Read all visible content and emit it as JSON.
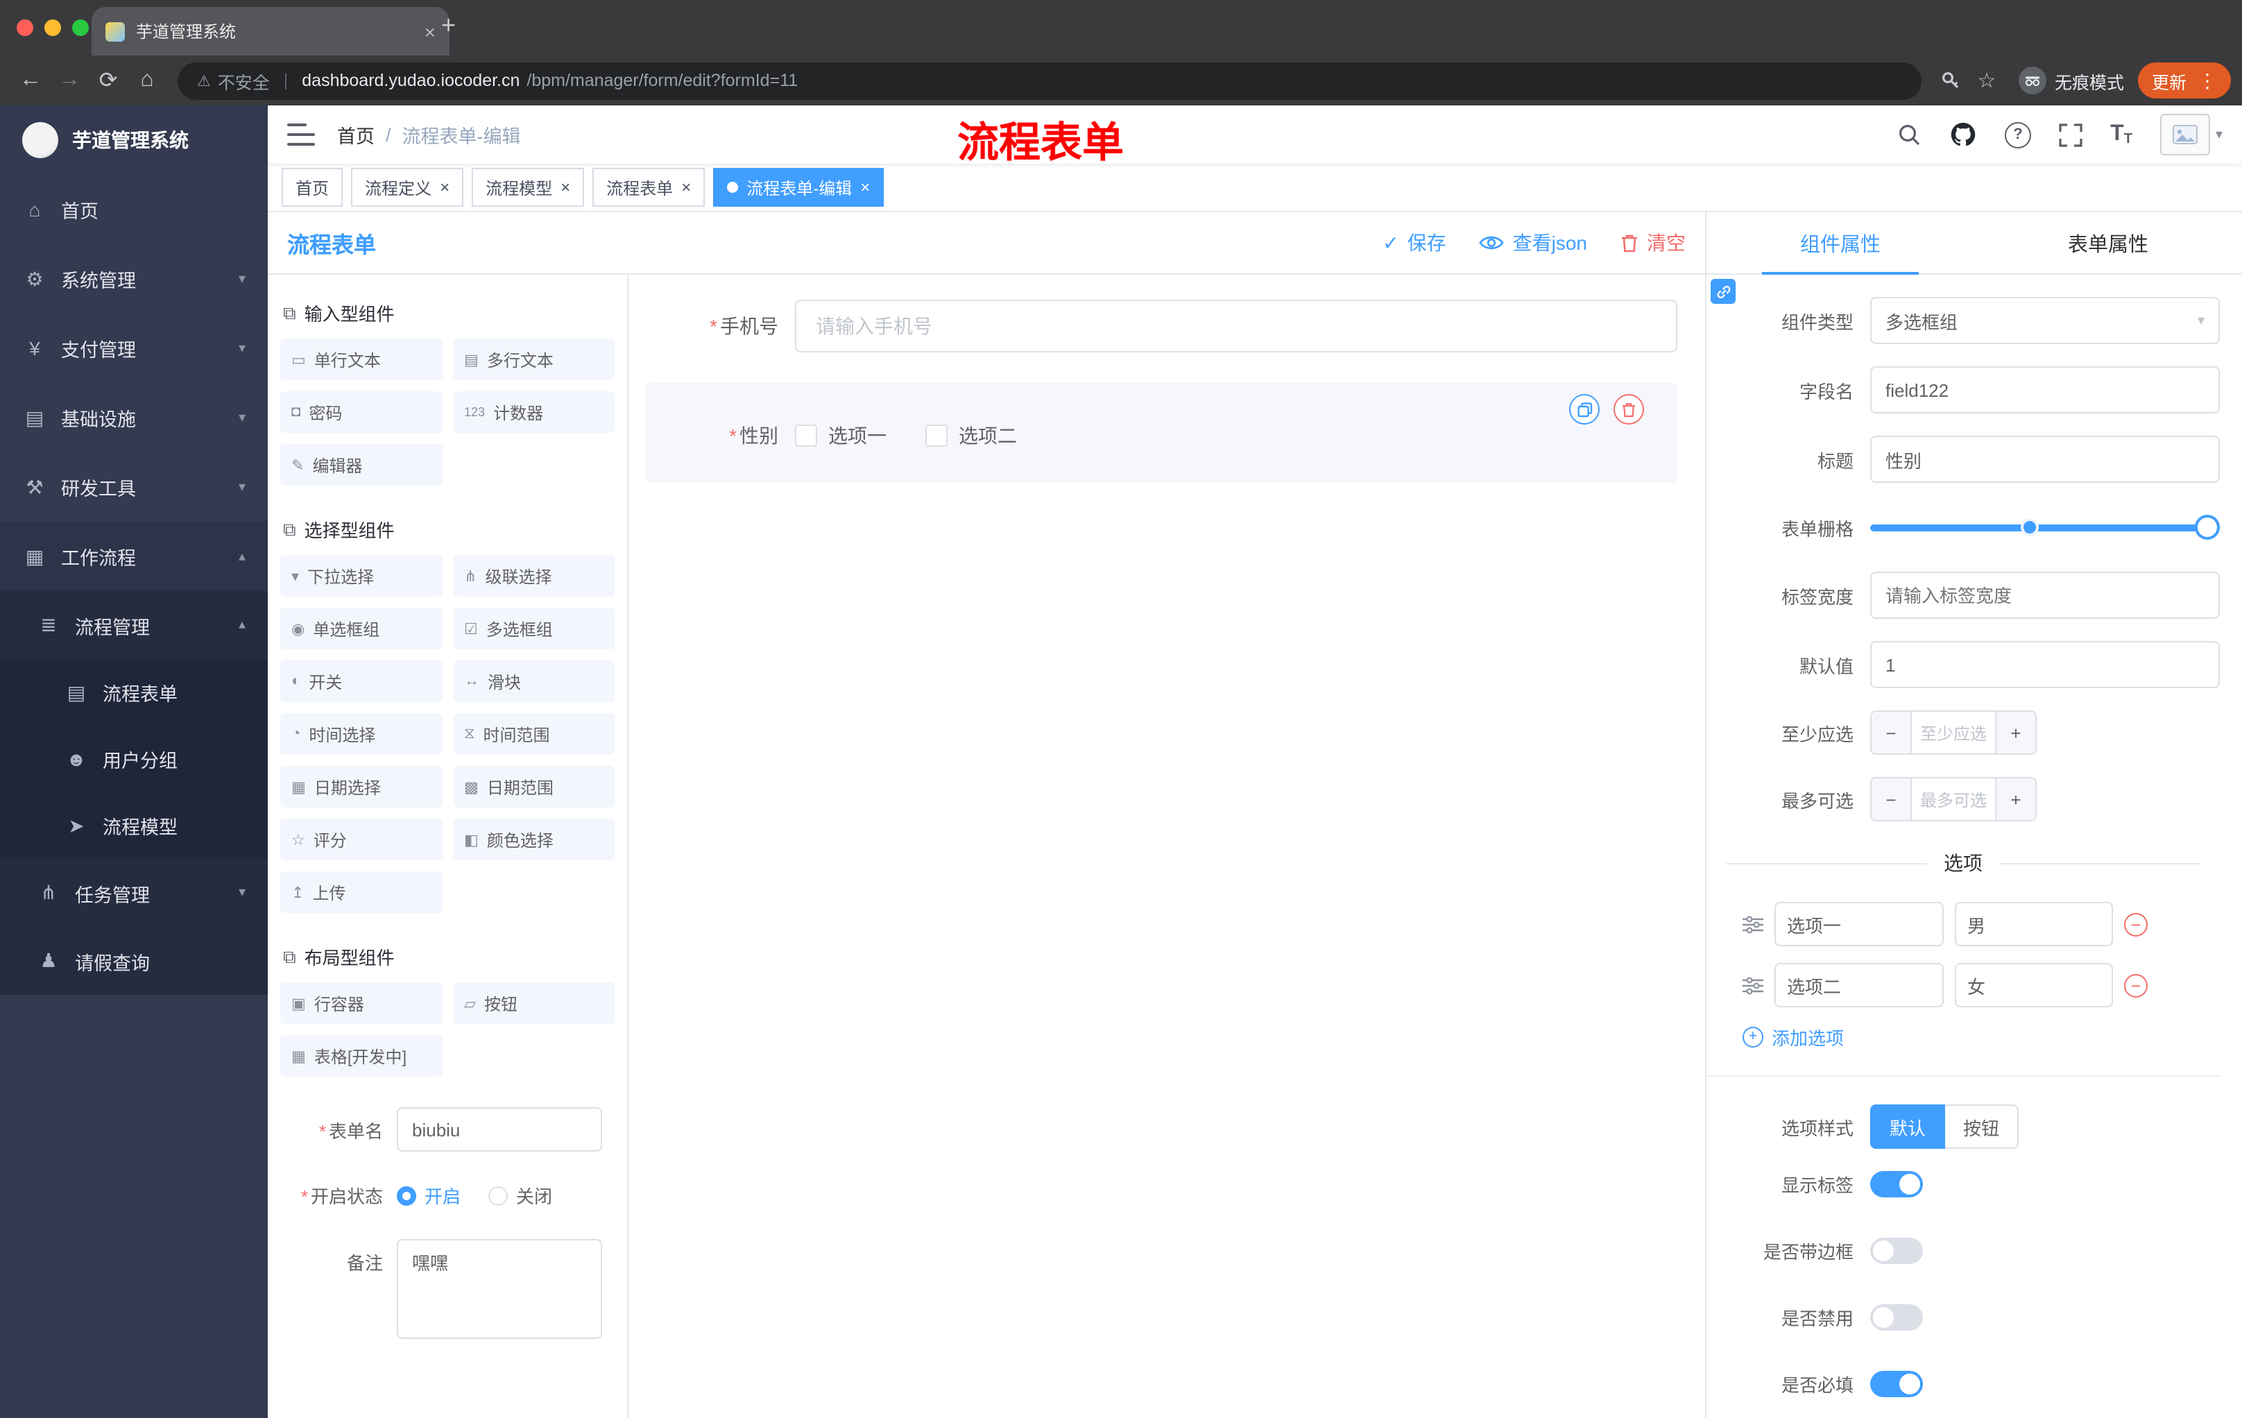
{
  "colors": {
    "primary": "#409eff",
    "danger": "#f56c6c",
    "annotation": "#ff0000"
  },
  "icons": {
    "back": "←",
    "forward": "→",
    "reload": "⟳",
    "home": "⌂",
    "star": "☆",
    "more": "⋮",
    "caret_down": "▾",
    "caret_up": "▴",
    "check": "✓",
    "close": "×",
    "plus": "+",
    "minus": "−",
    "question": "?",
    "asterisk": "*",
    "big_t": "T",
    "small_t": "T",
    "slash": "/"
  },
  "chrome": {
    "tab_title": "芋道管理系统",
    "security": "不安全",
    "url_domain": "dashboard.yudao.iocoder.cn",
    "url_path": "/bpm/manager/form/edit?formId=11",
    "incognito": "无痕模式",
    "update": "更新"
  },
  "annotation": {
    "text": "流程表单"
  },
  "sidebar": {
    "logo_title": "芋道管理系统",
    "items": [
      {
        "glyph": "⌂",
        "label": "首页"
      },
      {
        "glyph": "⚙",
        "label": "系统管理"
      },
      {
        "glyph": "¥",
        "label": "支付管理"
      },
      {
        "glyph": "▤",
        "label": "基础设施"
      },
      {
        "glyph": "⚒",
        "label": "研发工具"
      },
      {
        "glyph": "▦",
        "label": "工作流程"
      }
    ],
    "submenu": {
      "glyph": "≣",
      "label": "流程管理",
      "items": [
        {
          "glyph": "▤",
          "label": "流程表单"
        },
        {
          "glyph": "☻",
          "label": "用户分组"
        },
        {
          "glyph": "➤",
          "label": "流程模型"
        }
      ]
    },
    "tail": [
      {
        "glyph": "⋔",
        "label": "任务管理"
      },
      {
        "glyph": "♟",
        "label": "请假查询"
      }
    ]
  },
  "header": {
    "breadcrumb_home": "首页",
    "breadcrumb_current": "流程表单-编辑"
  },
  "tags": {
    "items": [
      {
        "label": "首页"
      },
      {
        "label": "流程定义"
      },
      {
        "label": "流程模型"
      },
      {
        "label": "流程表单"
      },
      {
        "label": "流程表单-编辑"
      }
    ]
  },
  "designer": {
    "title": "流程表单",
    "actions": {
      "save": "保存",
      "view_json": "查看json",
      "clear": "清空"
    },
    "groups": [
      {
        "glyph": "⧉",
        "title": "输入型组件",
        "items": [
          {
            "glyph": "▭",
            "label": "单行文本"
          },
          {
            "glyph": "▤",
            "label": "多行文本"
          },
          {
            "glyph": "◘",
            "label": "密码"
          },
          {
            "glyph": "123",
            "label": "计数器"
          },
          {
            "glyph": "✎",
            "label": "编辑器"
          }
        ]
      },
      {
        "glyph": "⧉",
        "title": "选择型组件",
        "items": [
          {
            "glyph": "▾",
            "label": "下拉选择"
          },
          {
            "glyph": "⋔",
            "label": "级联选择"
          },
          {
            "glyph": "◉",
            "label": "单选框组"
          },
          {
            "glyph": "☑",
            "label": "多选框组"
          },
          {
            "glyph": "◐",
            "label": "开关"
          },
          {
            "glyph": "↔",
            "label": "滑块"
          },
          {
            "glyph": "◔",
            "label": "时间选择"
          },
          {
            "glyph": "⧖",
            "label": "时间范围"
          },
          {
            "glyph": "▦",
            "label": "日期选择"
          },
          {
            "glyph": "▩",
            "label": "日期范围"
          },
          {
            "glyph": "☆",
            "label": "评分"
          },
          {
            "glyph": "◧",
            "label": "颜色选择"
          },
          {
            "glyph": "↥",
            "label": "上传"
          }
        ]
      },
      {
        "glyph": "⧉",
        "title": "布局型组件",
        "items": [
          {
            "glyph": "▣",
            "label": "行容器"
          },
          {
            "glyph": "▱",
            "label": "按钮"
          },
          {
            "glyph": "▦",
            "label": "表格[开发中]"
          }
        ]
      }
    ],
    "form": {
      "name_label": "表单名",
      "name_value": "biubiu",
      "status_label": "开启状态",
      "status_on": "开启",
      "status_off": "关闭",
      "remark_label": "备注",
      "remark_value": "嘿嘿"
    }
  },
  "canvas": {
    "phone": {
      "label": "手机号",
      "placeholder": "请输入手机号"
    },
    "gender": {
      "label": "性别",
      "options": [
        {
          "label": "选项一"
        },
        {
          "label": "选项二"
        }
      ]
    }
  },
  "props": {
    "tabs": {
      "component": "组件属性",
      "form": "表单属性"
    },
    "fields": {
      "type_label": "组件类型",
      "type_value": "多选框组",
      "field_label": "字段名",
      "field_value": "field122",
      "title_label": "标题",
      "title_value": "性别",
      "grid_label": "表单栅格",
      "label_width_label": "标签宽度",
      "label_width_placeholder": "请输入标签宽度",
      "default_label": "默认值",
      "default_value": "1",
      "min_label": "至少应选",
      "min_placeholder": "至少应选",
      "max_label": "最多可选",
      "max_placeholder": "最多可选"
    },
    "options": {
      "divider": "选项",
      "rows": [
        {
          "label": "选项一",
          "value": "男"
        },
        {
          "label": "选项二",
          "value": "女"
        }
      ],
      "add": "添加选项"
    },
    "style": {
      "label": "选项样式",
      "default": "默认",
      "button": "按钮"
    },
    "switches": [
      {
        "label": "显示标签",
        "on": true
      },
      {
        "label": "是否带边框",
        "on": false
      },
      {
        "label": "是否禁用",
        "on": false
      },
      {
        "label": "是否必填",
        "on": true
      }
    ]
  }
}
